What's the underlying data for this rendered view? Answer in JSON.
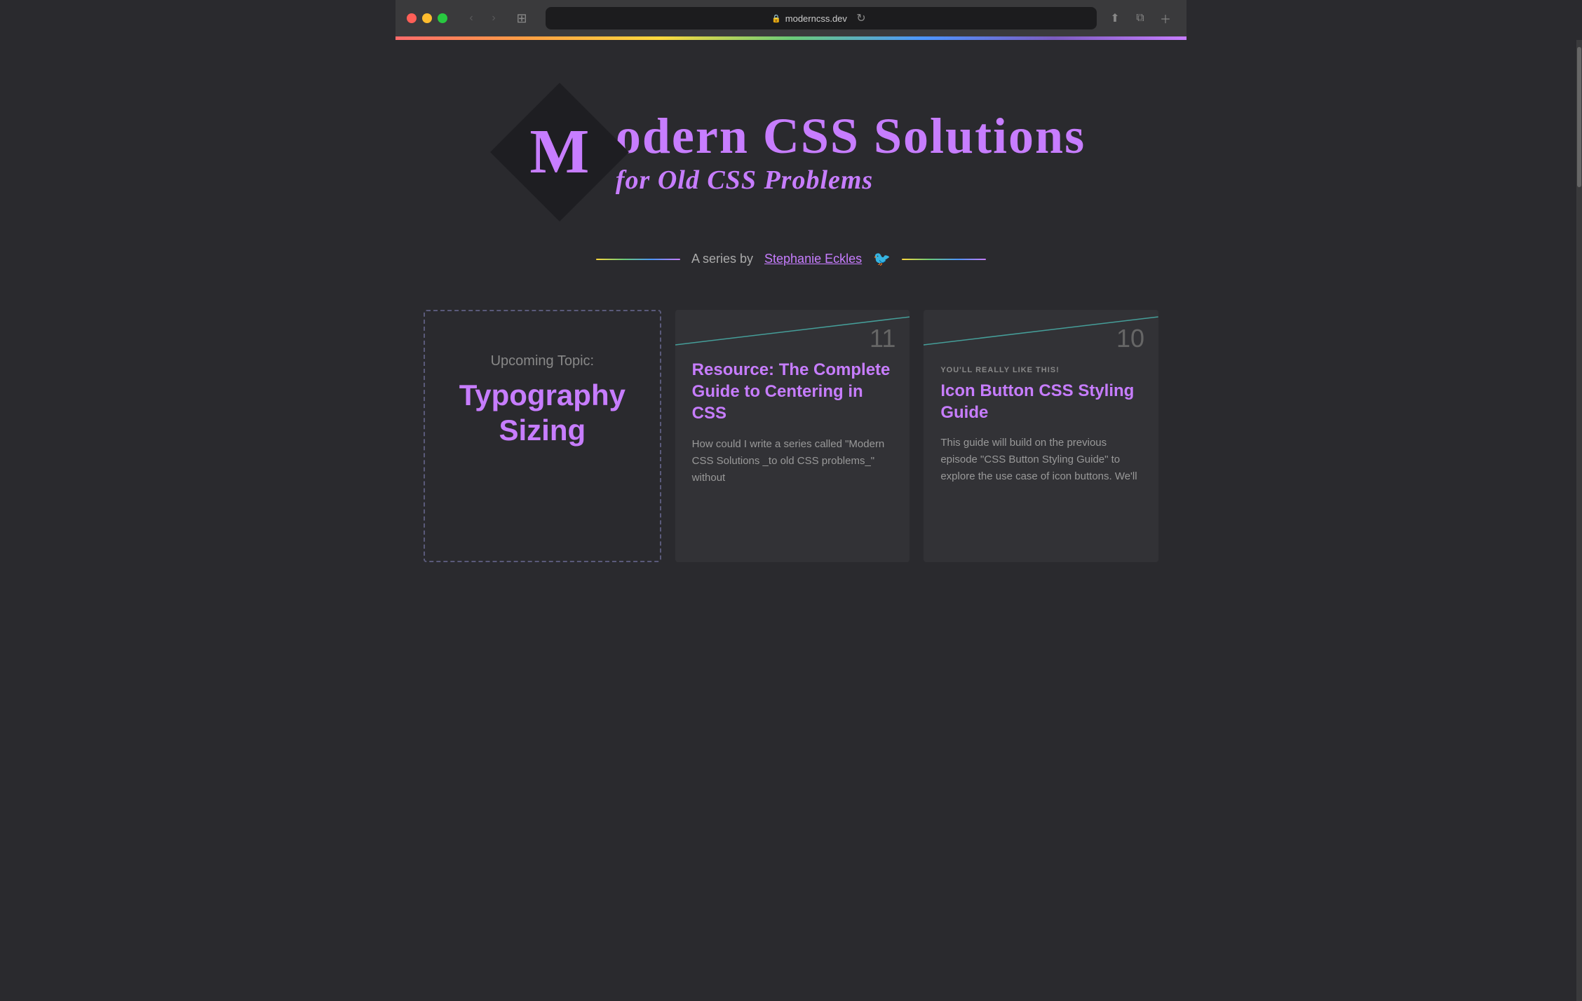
{
  "browser": {
    "url": "moderncss.dev",
    "back_btn": "‹",
    "forward_btn": "›"
  },
  "hero": {
    "logo_letter": "M",
    "title_main": "odern CSS Solutions",
    "title_sub": "for Old CSS Problems",
    "author_prefix": "A series by",
    "author_name": "Stephanie Eckles"
  },
  "cards": [
    {
      "type": "upcoming",
      "label": "Upcoming Topic:",
      "title": "Typography Sizing"
    },
    {
      "type": "article",
      "number": "11",
      "badge": "",
      "title": "Resource: The Complete Guide to Centering in CSS",
      "excerpt": "How could I write a series called \"Modern CSS Solutions _to old CSS problems_\" without"
    },
    {
      "type": "article",
      "number": "10",
      "badge": "YOU'LL REALLY LIKE THIS!",
      "title": "Icon Button CSS Styling Guide",
      "excerpt": "This guide will build on the previous episode \"CSS Button Styling Guide\" to explore the use case of icon buttons. We'll"
    }
  ]
}
